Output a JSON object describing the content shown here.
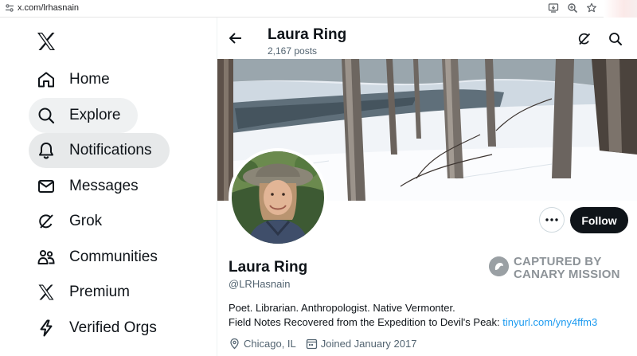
{
  "browser": {
    "url": "x.com/lrhasnain",
    "icons": [
      "site-settings-icon",
      "install-app-icon",
      "zoom-icon",
      "bookmark-star-icon"
    ]
  },
  "nav": {
    "logo": "x-logo-icon",
    "items": [
      {
        "label": "Home",
        "icon": "home-icon"
      },
      {
        "label": "Explore",
        "icon": "search-icon"
      },
      {
        "label": "Notifications",
        "icon": "bell-icon"
      },
      {
        "label": "Messages",
        "icon": "envelope-icon"
      },
      {
        "label": "Grok",
        "icon": "grok-icon"
      },
      {
        "label": "Communities",
        "icon": "communities-icon"
      },
      {
        "label": "Premium",
        "icon": "x-premium-icon"
      },
      {
        "label": "Verified Orgs",
        "icon": "lightning-icon"
      }
    ]
  },
  "header": {
    "name": "Laura Ring",
    "posts": "2,167 posts"
  },
  "profile": {
    "name": "Laura Ring",
    "handle": "@LRHasnain",
    "bio_line1": "Poet. Librarian. Anthropologist. Native Vermonter.",
    "bio_line2": "Field Notes Recovered from the Expedition to Devil's Peak: ",
    "bio_link": "tinyurl.com/yny4ffm3",
    "location": "Chicago, IL",
    "joined": "Joined January 2017",
    "follow_label": "Follow"
  },
  "watermark": {
    "line1": "CAPTURED BY",
    "line2": "CANARY MISSION"
  },
  "colors": {
    "accent": "#1d9bf0",
    "text": "#0f1419",
    "secondary": "#536471",
    "follow_bg": "#0f1419"
  }
}
